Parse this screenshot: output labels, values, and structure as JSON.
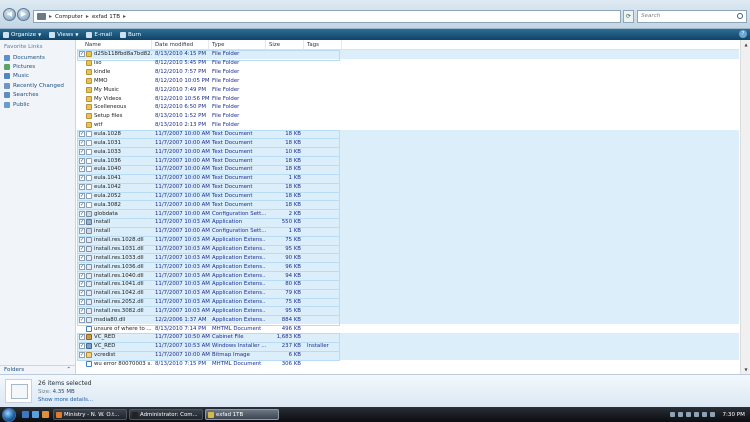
{
  "address": {
    "path": [
      "Computer",
      "exfad 1TB"
    ],
    "search_placeholder": "Search"
  },
  "toolbar": {
    "organize": "Organize",
    "views": "Views",
    "email": "E-mail",
    "burn": "Burn"
  },
  "sidebar": {
    "header": "Favorite Links",
    "items": [
      {
        "label": "Documents",
        "icon": "documents-icon",
        "color": "#5b8fcf"
      },
      {
        "label": "Pictures",
        "icon": "pictures-icon",
        "color": "#5aa46a"
      },
      {
        "label": "Music",
        "icon": "music-icon",
        "color": "#4f86c6"
      },
      {
        "label": "Recently Changed",
        "icon": "recent-icon",
        "color": "#6e96c0"
      },
      {
        "label": "Searches",
        "icon": "searches-icon",
        "color": "#5c8fbf"
      },
      {
        "label": "Public",
        "icon": "public-icon",
        "color": "#6a9bd0"
      }
    ],
    "folders_label": "Folders"
  },
  "columns": {
    "name": "Name",
    "date": "Date modified",
    "type": "Type",
    "size": "Size",
    "tags": "Tags"
  },
  "files": [
    {
      "name": "d25b118fbd8a7bd82...",
      "date": "8/13/2010 4:15 PM",
      "type": "File Folder",
      "size": "",
      "tags": "",
      "icon": "folder",
      "selected": true
    },
    {
      "name": "iso",
      "date": "8/12/2010 5:45 PM",
      "type": "File Folder",
      "size": "",
      "tags": "",
      "icon": "folder",
      "selected": false
    },
    {
      "name": "kindle",
      "date": "8/12/2010 7:57 PM",
      "type": "File Folder",
      "size": "",
      "tags": "",
      "icon": "folder",
      "selected": false
    },
    {
      "name": "MMO",
      "date": "8/12/2010 10:05 PM",
      "type": "File Folder",
      "size": "",
      "tags": "",
      "icon": "folder",
      "selected": false
    },
    {
      "name": "My Music",
      "date": "8/12/2010 7:49 PM",
      "type": "File Folder",
      "size": "",
      "tags": "",
      "icon": "folder",
      "selected": false
    },
    {
      "name": "My Videos",
      "date": "8/12/2010 10:56 PM",
      "type": "File Folder",
      "size": "",
      "tags": "",
      "icon": "folder",
      "selected": false
    },
    {
      "name": "Scelleneous",
      "date": "8/12/2010 6:50 PM",
      "type": "File Folder",
      "size": "",
      "tags": "",
      "icon": "folder",
      "selected": false
    },
    {
      "name": "Setup files",
      "date": "8/13/2010 1:52 PM",
      "type": "File Folder",
      "size": "",
      "tags": "",
      "icon": "folder",
      "selected": false
    },
    {
      "name": "wtf",
      "date": "8/13/2010 2:13 PM",
      "type": "File Folder",
      "size": "",
      "tags": "",
      "icon": "folder",
      "selected": false
    },
    {
      "name": "eula.1028",
      "date": "11/7/2007 10:00 AM",
      "type": "Text Document",
      "size": "18 KB",
      "tags": "",
      "icon": "doc",
      "selected": true
    },
    {
      "name": "eula.1031",
      "date": "11/7/2007 10:00 AM",
      "type": "Text Document",
      "size": "18 KB",
      "tags": "",
      "icon": "doc",
      "selected": true
    },
    {
      "name": "eula.1033",
      "date": "11/7/2007 10:00 AM",
      "type": "Text Document",
      "size": "10 KB",
      "tags": "",
      "icon": "doc",
      "selected": true
    },
    {
      "name": "eula.1036",
      "date": "11/7/2007 10:00 AM",
      "type": "Text Document",
      "size": "18 KB",
      "tags": "",
      "icon": "doc",
      "selected": true
    },
    {
      "name": "eula.1040",
      "date": "11/7/2007 10:00 AM",
      "type": "Text Document",
      "size": "18 KB",
      "tags": "",
      "icon": "doc",
      "selected": true
    },
    {
      "name": "eula.1041",
      "date": "11/7/2007 10:00 AM",
      "type": "Text Document",
      "size": "1 KB",
      "tags": "",
      "icon": "doc",
      "selected": true
    },
    {
      "name": "eula.1042",
      "date": "11/7/2007 10:00 AM",
      "type": "Text Document",
      "size": "18 KB",
      "tags": "",
      "icon": "doc",
      "selected": true
    },
    {
      "name": "eula.2052",
      "date": "11/7/2007 10:00 AM",
      "type": "Text Document",
      "size": "18 KB",
      "tags": "",
      "icon": "doc",
      "selected": true
    },
    {
      "name": "eula.3082",
      "date": "11/7/2007 10:00 AM",
      "type": "Text Document",
      "size": "18 KB",
      "tags": "",
      "icon": "doc",
      "selected": true
    },
    {
      "name": "globdata",
      "date": "11/7/2007 10:00 AM",
      "type": "Configuration Sett...",
      "size": "2 KB",
      "tags": "",
      "icon": "cfg",
      "selected": true
    },
    {
      "name": "install",
      "date": "11/7/2007 10:03 AM",
      "type": "Application",
      "size": "550 KB",
      "tags": "",
      "icon": "app",
      "selected": true
    },
    {
      "name": "install",
      "date": "11/7/2007 10:00 AM",
      "type": "Configuration Sett...",
      "size": "1 KB",
      "tags": "",
      "icon": "cfg",
      "selected": true
    },
    {
      "name": "install.res.1028.dll",
      "date": "11/7/2007 10:03 AM",
      "type": "Application Extens...",
      "size": "75 KB",
      "tags": "",
      "icon": "dll",
      "selected": true
    },
    {
      "name": "install.res.1031.dll",
      "date": "11/7/2007 10:03 AM",
      "type": "Application Extens...",
      "size": "95 KB",
      "tags": "",
      "icon": "dll",
      "selected": true
    },
    {
      "name": "install.res.1033.dll",
      "date": "11/7/2007 10:03 AM",
      "type": "Application Extens...",
      "size": "90 KB",
      "tags": "",
      "icon": "dll",
      "selected": true
    },
    {
      "name": "install.res.1036.dll",
      "date": "11/7/2007 10:03 AM",
      "type": "Application Extens...",
      "size": "96 KB",
      "tags": "",
      "icon": "dll",
      "selected": true
    },
    {
      "name": "install.res.1040.dll",
      "date": "11/7/2007 10:03 AM",
      "type": "Application Extens...",
      "size": "94 KB",
      "tags": "",
      "icon": "dll",
      "selected": true
    },
    {
      "name": "install.res.1041.dll",
      "date": "11/7/2007 10:03 AM",
      "type": "Application Extens...",
      "size": "80 KB",
      "tags": "",
      "icon": "dll",
      "selected": true
    },
    {
      "name": "install.res.1042.dll",
      "date": "11/7/2007 10:03 AM",
      "type": "Application Extens...",
      "size": "79 KB",
      "tags": "",
      "icon": "dll",
      "selected": true
    },
    {
      "name": "install.res.2052.dll",
      "date": "11/7/2007 10:03 AM",
      "type": "Application Extens...",
      "size": "75 KB",
      "tags": "",
      "icon": "dll",
      "selected": true
    },
    {
      "name": "install.res.3082.dll",
      "date": "11/7/2007 10:03 AM",
      "type": "Application Extens...",
      "size": "95 KB",
      "tags": "",
      "icon": "dll",
      "selected": true
    },
    {
      "name": "msdia80.dll",
      "date": "12/2/2006 1:37 AM",
      "type": "Application Extens...",
      "size": "884 KB",
      "tags": "",
      "icon": "dll",
      "selected": true
    },
    {
      "name": "unsure of where to ...",
      "date": "8/13/2010 7:14 PM",
      "type": "MHTML Document",
      "size": "496 KB",
      "tags": "",
      "icon": "mht",
      "selected": false
    },
    {
      "name": "VC_RED",
      "date": "11/7/2007 10:50 AM",
      "type": "Cabinet File",
      "size": "1,683 KB",
      "tags": "",
      "icon": "cab",
      "selected": true
    },
    {
      "name": "VC_RED",
      "date": "11/7/2007 10:53 AM",
      "type": "Windows Installer ...",
      "size": "237 KB",
      "tags": "Installer",
      "icon": "msi",
      "selected": true
    },
    {
      "name": "vcredist",
      "date": "11/7/2007 10:00 AM",
      "type": "Bitmap Image",
      "size": "6 KB",
      "tags": "",
      "icon": "bmp",
      "selected": true
    },
    {
      "name": "wu error 80070003 s...",
      "date": "8/13/2010 7:15 PM",
      "type": "MHTML Document",
      "size": "306 KB",
      "tags": "",
      "icon": "mht",
      "selected": false
    }
  ],
  "details": {
    "count": "26 items selected",
    "size_label": "Size:",
    "size_value": "4.35 MB",
    "more": "Show more details..."
  },
  "taskbar": {
    "tasks": [
      {
        "label": "Ministry - N. W. O.t...",
        "color": "#e07b2a",
        "active": false
      },
      {
        "label": "Administrator: Com...",
        "color": "#222222",
        "active": false
      },
      {
        "label": "exfad 1TB",
        "color": "#d7b84c",
        "active": true
      }
    ],
    "quicklaunch": [
      "#3a78c2",
      "#5aa0e0",
      "#e0903a"
    ],
    "clock": "7:30 PM"
  }
}
